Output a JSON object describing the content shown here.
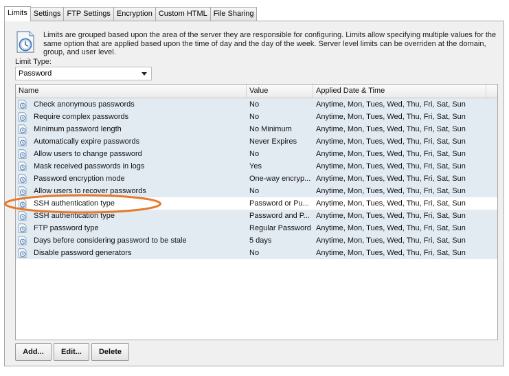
{
  "tabs": [
    {
      "label": "Limits",
      "active": true
    },
    {
      "label": "Settings",
      "active": false
    },
    {
      "label": "FTP Settings",
      "active": false
    },
    {
      "label": "Encryption",
      "active": false
    },
    {
      "label": "Custom HTML",
      "active": false
    },
    {
      "label": "File Sharing",
      "active": false
    }
  ],
  "description": "Limits are grouped based upon the area of the server they are responsible for configuring. Limits allow specifying multiple values for the same option that are applied based upon the time of day and the day of the week. Server level limits can be overriden at the domain, group, and user level.",
  "limit_type": {
    "label": "Limit Type:",
    "value": "Password"
  },
  "grid": {
    "columns": [
      "Name",
      "Value",
      "Applied Date & Time"
    ],
    "rows": [
      {
        "name": "Check anonymous passwords",
        "value": "No",
        "applied": "Anytime, Mon, Tues, Wed, Thu, Fri, Sat, Sun"
      },
      {
        "name": "Require complex passwords",
        "value": "No",
        "applied": "Anytime, Mon, Tues, Wed, Thu, Fri, Sat, Sun"
      },
      {
        "name": "Minimum password length",
        "value": "No Minimum",
        "applied": "Anytime, Mon, Tues, Wed, Thu, Fri, Sat, Sun"
      },
      {
        "name": "Automatically expire passwords",
        "value": "Never Expires",
        "applied": "Anytime, Mon, Tues, Wed, Thu, Fri, Sat, Sun"
      },
      {
        "name": "Allow users to change password",
        "value": "No",
        "applied": "Anytime, Mon, Tues, Wed, Thu, Fri, Sat, Sun"
      },
      {
        "name": "Mask received passwords in logs",
        "value": "Yes",
        "applied": "Anytime, Mon, Tues, Wed, Thu, Fri, Sat, Sun"
      },
      {
        "name": "Password encryption mode",
        "value": "One-way encryp...",
        "applied": "Anytime, Mon, Tues, Wed, Thu, Fri, Sat, Sun"
      },
      {
        "name": "Allow users to recover passwords",
        "value": "No",
        "applied": "Anytime, Mon, Tues, Wed, Thu, Fri, Sat, Sun"
      },
      {
        "name": "SSH authentication type",
        "value": "Password or Pu...",
        "applied": "Anytime, Mon, Tues, Wed, Thu, Fri, Sat, Sun",
        "selected": true
      },
      {
        "name": "SSH authentication type",
        "value": "Password and P...",
        "applied": "Anytime, Mon, Tues, Wed, Thu, Fri, Sat, Sun"
      },
      {
        "name": "FTP password type",
        "value": "Regular Password",
        "applied": "Anytime, Mon, Tues, Wed, Thu, Fri, Sat, Sun"
      },
      {
        "name": "Days before considering password to be stale",
        "value": "5 days",
        "applied": "Anytime, Mon, Tues, Wed, Thu, Fri, Sat, Sun"
      },
      {
        "name": "Disable password generators",
        "value": "No",
        "applied": "Anytime, Mon, Tues, Wed, Thu, Fri, Sat, Sun"
      }
    ]
  },
  "buttons": {
    "add": "Add...",
    "edit": "Edit...",
    "delete": "Delete"
  },
  "colors": {
    "highlight_ellipse": "#e8782a",
    "row_background": "#e2ebf2",
    "selected_row": "#ffffff"
  },
  "icons": {
    "limit_info": "clock-document-icon",
    "row": "clock-document-icon"
  }
}
